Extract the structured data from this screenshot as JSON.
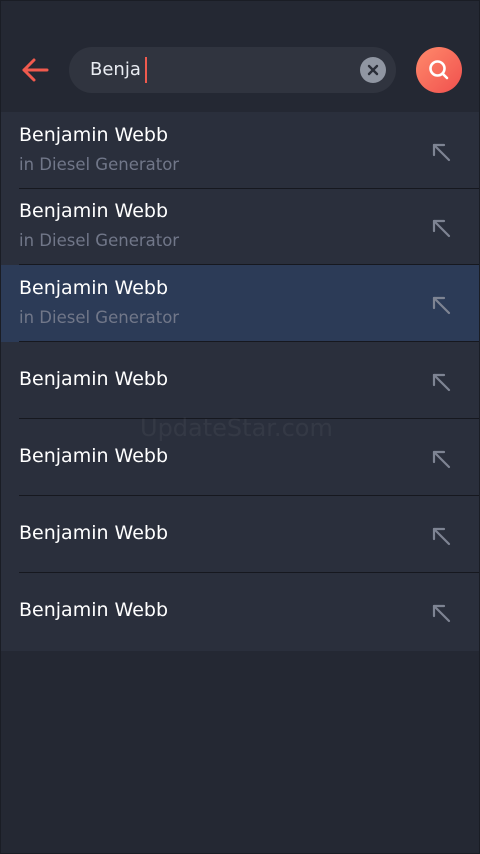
{
  "colors": {
    "background": "#242833",
    "list_background": "#2a2f3c",
    "selected_row": "#2c3b57",
    "accent": "#f05a4e",
    "subtitle": "#717789"
  },
  "header": {
    "back_icon": "arrow-left-icon",
    "search": {
      "value": "Benja",
      "clear_icon": "close-icon"
    },
    "search_button_icon": "search-icon"
  },
  "results": [
    {
      "title": "Benjamin Webb",
      "subtitle": "in Diesel Generator",
      "selected": false,
      "action_icon": "arrow-up-left-icon"
    },
    {
      "title": "Benjamin Webb",
      "subtitle": "in Diesel Generator",
      "selected": false,
      "action_icon": "arrow-up-left-icon"
    },
    {
      "title": "Benjamin Webb",
      "subtitle": "in Diesel Generator",
      "selected": true,
      "action_icon": "arrow-up-left-icon"
    },
    {
      "title": "Benjamin Webb",
      "subtitle": "",
      "selected": false,
      "action_icon": "arrow-up-left-icon"
    },
    {
      "title": "Benjamin Webb",
      "subtitle": "",
      "selected": false,
      "action_icon": "arrow-up-left-icon"
    },
    {
      "title": "Benjamin Webb",
      "subtitle": "",
      "selected": false,
      "action_icon": "arrow-up-left-icon"
    },
    {
      "title": "Benjamin Webb",
      "subtitle": "",
      "selected": false,
      "action_icon": "arrow-up-left-icon"
    }
  ],
  "watermark": "UpdateStar.com"
}
